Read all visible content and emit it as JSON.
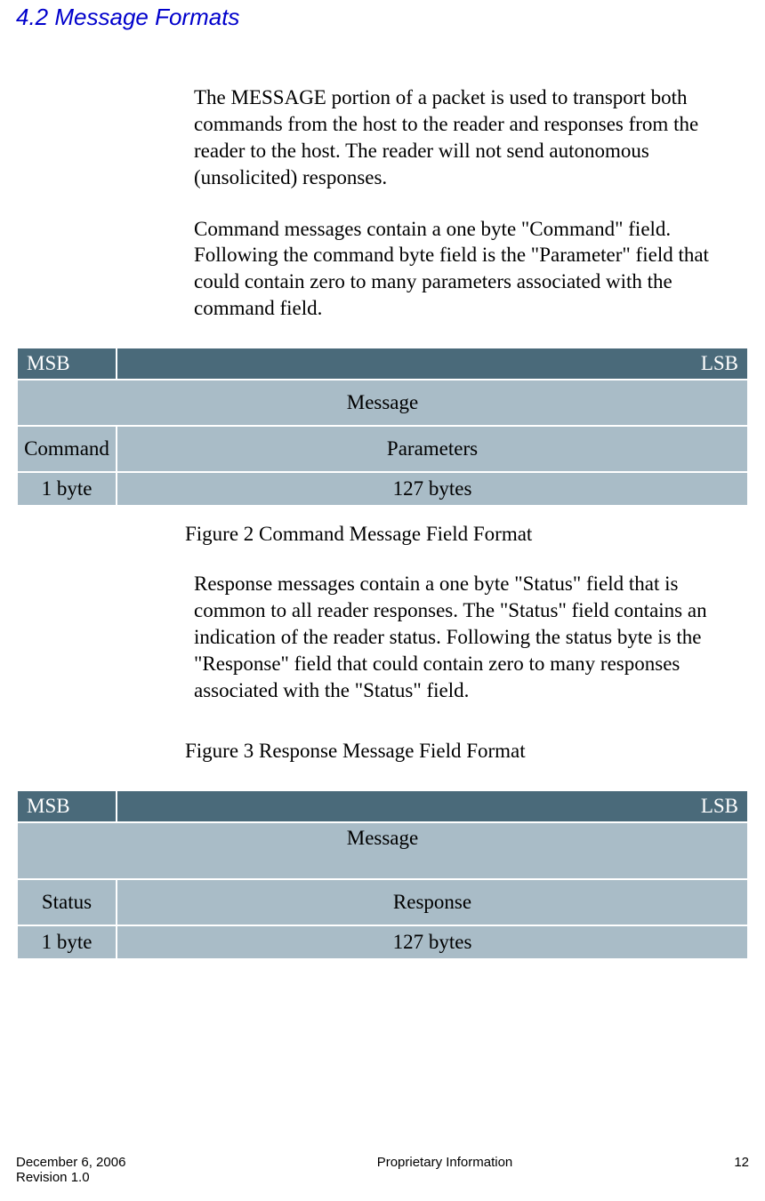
{
  "heading": "4.2  Message Formats",
  "para1": "The MESSAGE portion of a packet is used to transport both commands from the host to the reader and responses from the reader to the host.  The reader will not send autonomous (unsolicited) responses.",
  "para2": "Command messages contain a one byte \"Command\" field.  Following the command byte field is the \"Parameter\" field that could contain zero to many parameters associated with the command field.",
  "table1": {
    "msb": "MSB",
    "lsb": "LSB",
    "message": "Message",
    "col1": "Command",
    "col2": "Parameters",
    "size1": "1 byte",
    "size2": "127 bytes"
  },
  "caption1": "Figure 2 Command Message Field Format",
  "para3": "Response messages contain a one byte \"Status\" field that is common to all reader responses.  The \"Status\" field contains an indication of the reader status.  Following the status byte is the \"Response\" field that could contain zero to many responses associated with the \"Status\" field.",
  "caption2": "Figure 3 Response Message Field Format",
  "table2": {
    "msb": "MSB",
    "lsb": "LSB",
    "message": "Message",
    "col1": "Status",
    "col2": "Response",
    "size1": "1 byte",
    "size2": "127 bytes"
  },
  "footer": {
    "date": "December 6, 2006",
    "revision": "Revision 1.0",
    "center": "Proprietary Information",
    "page": "12"
  }
}
